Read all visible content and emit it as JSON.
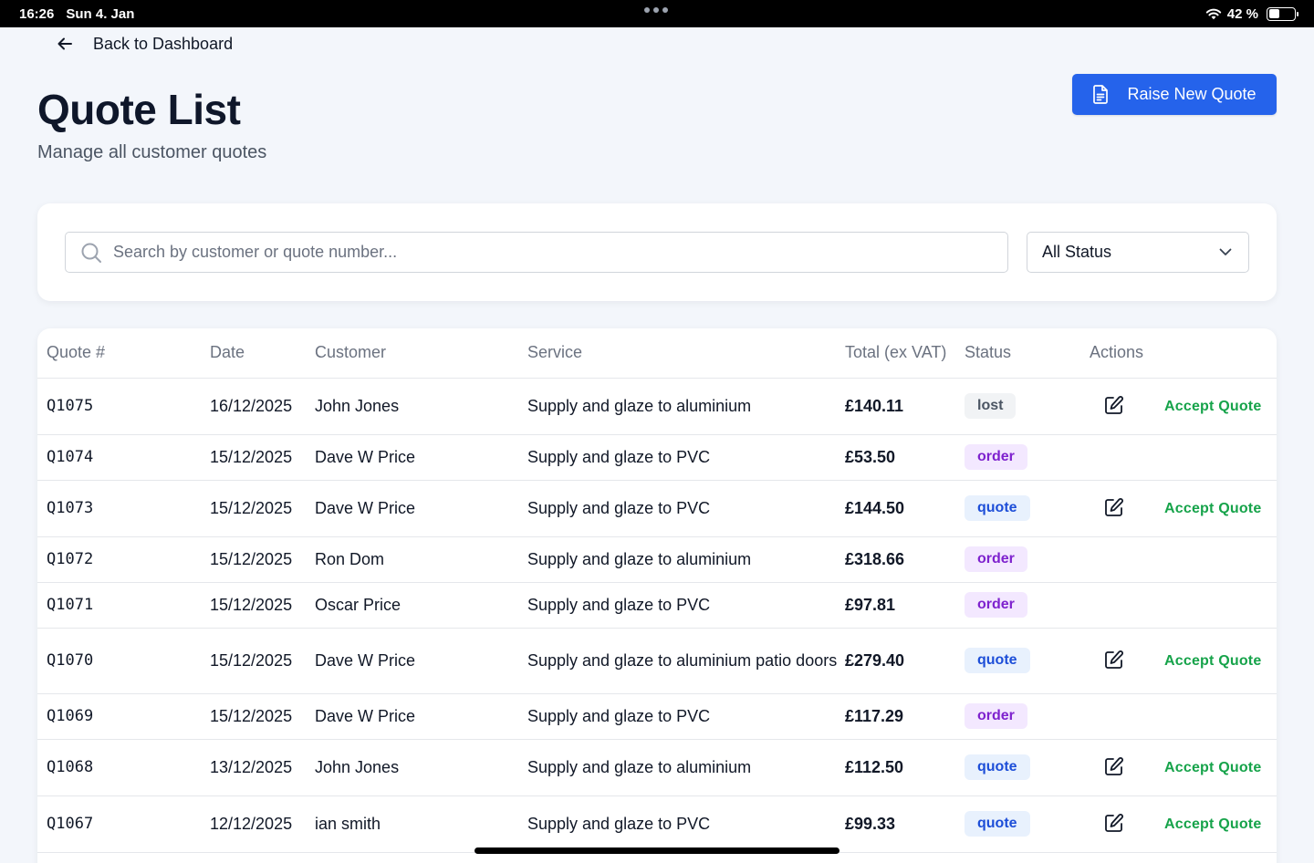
{
  "status_bar": {
    "time": "16:26",
    "date": "Sun 4. Jan",
    "battery": "42 %",
    "battery_level": 0.42
  },
  "nav": {
    "back_label": "Back to Dashboard",
    "back_icon": "arrow-left-icon"
  },
  "header": {
    "title": "Quote List",
    "subtitle": "Manage all customer quotes",
    "raise_button": "Raise New Quote",
    "raise_icon": "document-icon"
  },
  "filters": {
    "search_placeholder": "Search by customer or quote number...",
    "search_value": "",
    "status_selected": "All Status"
  },
  "colors": {
    "primary": "#2563eb",
    "accept": "#16a34a",
    "lost_bg": "#f1f3f5",
    "lost_fg": "#4b5563",
    "order_bg": "#f3e8ff",
    "order_fg": "#7e22ce",
    "quote_bg": "#e8f1fd",
    "quote_fg": "#1d4ed8"
  },
  "table": {
    "headers": {
      "quote": "Quote #",
      "date": "Date",
      "customer": "Customer",
      "service": "Service",
      "total": "Total (ex VAT)",
      "status": "Status",
      "actions": "Actions"
    },
    "accept_label": "Accept Quote",
    "rows": [
      {
        "quote": "Q1075",
        "date": "16/12/2025",
        "customer": "John Jones",
        "service": "Supply and glaze to aluminium",
        "total": "£140.11",
        "status": "lost",
        "editable": true
      },
      {
        "quote": "Q1074",
        "date": "15/12/2025",
        "customer": "Dave W Price",
        "service": "Supply and glaze to PVC",
        "total": "£53.50",
        "status": "order",
        "editable": false
      },
      {
        "quote": "Q1073",
        "date": "15/12/2025",
        "customer": "Dave W Price",
        "service": "Supply and glaze to PVC",
        "total": "£144.50",
        "status": "quote",
        "editable": true
      },
      {
        "quote": "Q1072",
        "date": "15/12/2025",
        "customer": "Ron Dom",
        "service": "Supply and glaze to aluminium",
        "total": "£318.66",
        "status": "order",
        "editable": false
      },
      {
        "quote": "Q1071",
        "date": "15/12/2025",
        "customer": "Oscar Price",
        "service": "Supply and glaze to PVC",
        "total": "£97.81",
        "status": "order",
        "editable": false
      },
      {
        "quote": "Q1070",
        "date": "15/12/2025",
        "customer": "Dave W Price",
        "service": "Supply and glaze to aluminium patio doors",
        "total": "£279.40",
        "status": "quote",
        "editable": true
      },
      {
        "quote": "Q1069",
        "date": "15/12/2025",
        "customer": "Dave W Price",
        "service": "Supply and glaze to PVC",
        "total": "£117.29",
        "status": "order",
        "editable": false
      },
      {
        "quote": "Q1068",
        "date": "13/12/2025",
        "customer": "John Jones",
        "service": "Supply and glaze to aluminium",
        "total": "£112.50",
        "status": "quote",
        "editable": true
      },
      {
        "quote": "Q1067",
        "date": "12/12/2025",
        "customer": "ian smith",
        "service": "Supply and glaze to PVC",
        "total": "£99.33",
        "status": "quote",
        "editable": true
      }
    ]
  }
}
